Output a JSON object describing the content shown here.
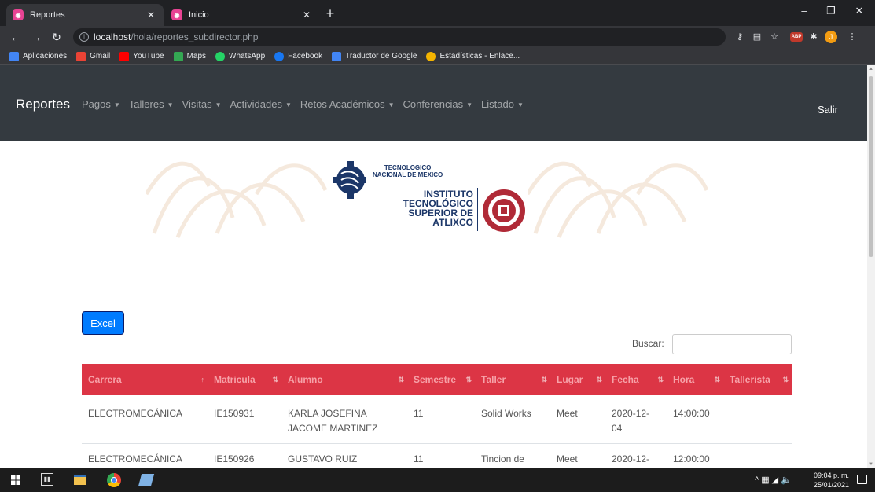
{
  "browser": {
    "tabs": [
      {
        "title": "Reportes",
        "active": true
      },
      {
        "title": "Inicio",
        "active": false
      }
    ],
    "address": {
      "host": "localhost",
      "path": "/hola/reportes_subdirector.php"
    },
    "bookmarks": [
      {
        "label": "Aplicaciones",
        "icon": "apps-icon",
        "color": "#4285f4"
      },
      {
        "label": "Gmail",
        "icon": "gmail-icon",
        "color": "#ea4335"
      },
      {
        "label": "YouTube",
        "icon": "youtube-icon",
        "color": "#ff0000"
      },
      {
        "label": "Maps",
        "icon": "maps-icon",
        "color": "#34a853"
      },
      {
        "label": "WhatsApp",
        "icon": "whatsapp-icon",
        "color": "#25d366"
      },
      {
        "label": "Facebook",
        "icon": "facebook-icon",
        "color": "#1877f2"
      },
      {
        "label": "Traductor de Google",
        "icon": "translate-icon",
        "color": "#4285f4"
      },
      {
        "label": "Estadísticas - Enlace...",
        "icon": "stats-icon",
        "color": "#f4b400"
      }
    ],
    "avatar_initial": "J",
    "abp_label": "ABP"
  },
  "navbar": {
    "brand": "Reportes",
    "menu": [
      "Pagos",
      "Talleres",
      "Visitas",
      "Actividades",
      "Retos Académicos",
      "Conferencias",
      "Listado"
    ],
    "logout": "Salir"
  },
  "banner": {
    "tnm_line1": "TECNOLOGICO",
    "tnm_line2": "NACIONAL DE MEXICO",
    "inst_line1": "INSTITUTO",
    "inst_line2": "TECNOLÓGICO",
    "inst_line3": "SUPERIOR DE",
    "inst_line4": "ATLIXCO"
  },
  "actions": {
    "excel": "Excel"
  },
  "search": {
    "label": "Buscar:",
    "value": ""
  },
  "table": {
    "headers": [
      "Carrera",
      "Matricula",
      "Alumno",
      "Semestre",
      "Taller",
      "Lugar",
      "Fecha",
      "Hora",
      "Tallerista"
    ],
    "rows": [
      {
        "carrera": "ELECTROMECÁNICA",
        "matricula": "IE150931",
        "alumno_l1": "KARLA JOSEFINA",
        "alumno_l2": "JACOME MARTINEZ",
        "semestre": "11",
        "taller_l1": "Solid Works",
        "taller_l2": "",
        "lugar": "Meet",
        "fecha_l1": "2020-12-",
        "fecha_l2": "04",
        "hora": "14:00:00",
        "tallerista": ""
      },
      {
        "carrera": "ELECTROMECÁNICA",
        "matricula": "IE150926",
        "alumno_l1": "GUSTAVO RUIZ",
        "alumno_l2": "",
        "semestre": "11",
        "taller_l1": "Tincion de",
        "taller_l2": "",
        "lugar": "Meet",
        "fecha_l1": "2020-12-",
        "fecha_l2": "",
        "hora": "12:00:00",
        "tallerista": ""
      }
    ]
  },
  "taskbar": {
    "time": "09:04 p. m.",
    "date": "25/01/2021"
  }
}
